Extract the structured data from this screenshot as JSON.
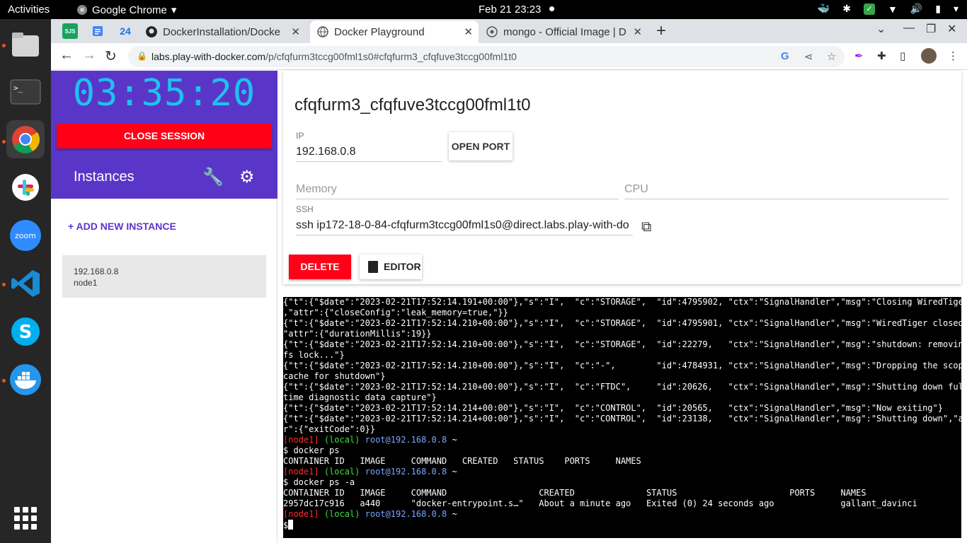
{
  "system": {
    "activities": "Activities",
    "app_menu": "Google Chrome",
    "clock": "Feb 21  23:23"
  },
  "browser": {
    "tabs": [
      {
        "title": "DockerInstallation/Docke"
      },
      {
        "title": "Docker Playground"
      },
      {
        "title": "mongo - Official Image | D"
      }
    ],
    "pinned": [
      "SJS",
      "",
      "24"
    ],
    "url_host": "labs.play-with-docker.com",
    "url_path": "/p/cfqfurm3tccg00fml1s0#cfqfurm3_cfqfuve3tccg00fml1t0"
  },
  "sidebar": {
    "timer": "03:35:20",
    "close_session": "CLOSE SESSION",
    "instances_title": "Instances",
    "add_instance": "+ ADD NEW INSTANCE",
    "instance": {
      "ip": "192.168.0.8",
      "name": "node1"
    }
  },
  "details": {
    "title": "cfqfurm3_cfqfuve3tccg00fml1t0",
    "ip_label": "IP",
    "ip_value": "192.168.0.8",
    "open_port": "OPEN PORT",
    "memory_label": "Memory",
    "cpu_label": "CPU",
    "ssh_label": "SSH",
    "ssh_value": "ssh ip172-18-0-84-cfqfurm3tccg00fml1s0@direct.labs.play-with-do",
    "delete": "DELETE",
    "editor": "EDITOR"
  },
  "terminal": {
    "lines": [
      "{\"t\":{\"$date\":\"2023-02-21T17:52:14.191+00:00\"},\"s\":\"I\",  \"c\":\"STORAGE\",  \"id\":4795902, \"ctx\":\"SignalHandler\",\"msg\":\"Closing WiredTiger\"",
      ",\"attr\":{\"closeConfig\":\"leak_memory=true,\"}}",
      "{\"t\":{\"$date\":\"2023-02-21T17:52:14.210+00:00\"},\"s\":\"I\",  \"c\":\"STORAGE\",  \"id\":4795901, \"ctx\":\"SignalHandler\",\"msg\":\"WiredTiger closed\",",
      "\"attr\":{\"durationMillis\":19}}",
      "{\"t\":{\"$date\":\"2023-02-21T17:52:14.210+00:00\"},\"s\":\"I\",  \"c\":\"STORAGE\",  \"id\":22279,   \"ctx\":\"SignalHandler\",\"msg\":\"shutdown: removing",
      "fs lock...\"}",
      "{\"t\":{\"$date\":\"2023-02-21T17:52:14.210+00:00\"},\"s\":\"I\",  \"c\":\"-\",        \"id\":4784931, \"ctx\":\"SignalHandler\",\"msg\":\"Dropping the scope",
      "cache for shutdown\"}",
      "{\"t\":{\"$date\":\"2023-02-21T17:52:14.210+00:00\"},\"s\":\"I\",  \"c\":\"FTDC\",     \"id\":20626,   \"ctx\":\"SignalHandler\",\"msg\":\"Shutting down full-",
      "time diagnostic data capture\"}",
      "{\"t\":{\"$date\":\"2023-02-21T17:52:14.214+00:00\"},\"s\":\"I\",  \"c\":\"CONTROL\",  \"id\":20565,   \"ctx\":\"SignalHandler\",\"msg\":\"Now exiting\"}",
      "{\"t\":{\"$date\":\"2023-02-21T17:52:14.214+00:00\"},\"s\":\"I\",  \"c\":\"CONTROL\",  \"id\":23138,   \"ctx\":\"SignalHandler\",\"msg\":\"Shutting down\",\"att",
      "r\":{\"exitCode\":0}}"
    ],
    "prompt": {
      "node": "[node1]",
      "local": "(local)",
      "host": "root@192.168.0.8",
      "tilde": "~"
    },
    "cmd1": "$ docker ps",
    "header1": "CONTAINER ID   IMAGE     COMMAND   CREATED   STATUS    PORTS     NAMES",
    "cmd2": "$ docker ps -a",
    "header2": "CONTAINER ID   IMAGE     COMMAND                  CREATED              STATUS                      PORTS     NAMES",
    "row2": "2957dc17c916   a440      \"docker-entrypoint.s…\"   About a minute ago   Exited (0) 24 seconds ago             gallant_davinci",
    "final_prompt": "$"
  },
  "colors": {
    "accent_purple": "#5a36c8",
    "danger_red": "#ff0017",
    "timer_cyan": "#1ec2f0"
  },
  "icons": [
    "wrench-icon",
    "gear-icon",
    "copy-icon",
    "document-icon",
    "lock-icon",
    "google-icon",
    "share-icon",
    "star-icon",
    "extensions-icon"
  ]
}
